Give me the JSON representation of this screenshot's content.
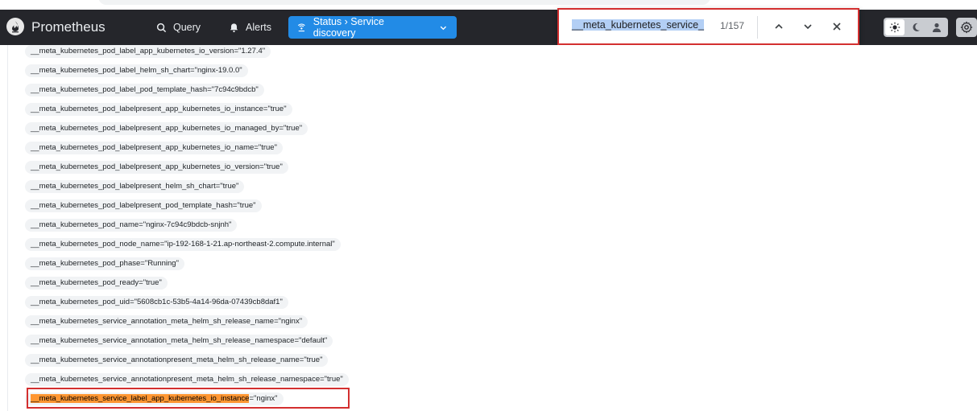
{
  "header": {
    "brand": "Prometheus",
    "nav": {
      "query": "Query",
      "alerts": "Alerts",
      "status": "Status › Service discovery"
    }
  },
  "find": {
    "query_text": "__meta_kubernetes_service_",
    "count": "1/157"
  },
  "labels": [
    {
      "text": "__meta_kubernetes_pod_label_app_kubernetes_io_version=\"1.27.4\""
    },
    {
      "text": "__meta_kubernetes_pod_label_helm_sh_chart=\"nginx-19.0.0\""
    },
    {
      "text": "__meta_kubernetes_pod_label_pod_template_hash=\"7c94c9bdcb\""
    },
    {
      "text": "__meta_kubernetes_pod_labelpresent_app_kubernetes_io_instance=\"true\""
    },
    {
      "text": "__meta_kubernetes_pod_labelpresent_app_kubernetes_io_managed_by=\"true\""
    },
    {
      "text": "__meta_kubernetes_pod_labelpresent_app_kubernetes_io_name=\"true\""
    },
    {
      "text": "__meta_kubernetes_pod_labelpresent_app_kubernetes_io_version=\"true\""
    },
    {
      "text": "__meta_kubernetes_pod_labelpresent_helm_sh_chart=\"true\""
    },
    {
      "text": "__meta_kubernetes_pod_labelpresent_pod_template_hash=\"true\""
    },
    {
      "text": "__meta_kubernetes_pod_name=\"nginx-7c94c9bdcb-snjnh\""
    },
    {
      "text": "__meta_kubernetes_pod_node_name=\"ip-192-168-1-21.ap-northeast-2.compute.internal\""
    },
    {
      "text": "__meta_kubernetes_pod_phase=\"Running\""
    },
    {
      "text": "__meta_kubernetes_pod_ready=\"true\""
    },
    {
      "text": "__meta_kubernetes_pod_uid=\"5608cb1c-53b5-4a14-96da-07439cb8daf1\""
    },
    {
      "text": "__meta_kubernetes_service_annotation_meta_helm_sh_release_name=\"nginx\""
    },
    {
      "text": "__meta_kubernetes_service_annotation_meta_helm_sh_release_namespace=\"default\""
    },
    {
      "text": "__meta_kubernetes_service_annotationpresent_meta_helm_sh_release_name=\"true\""
    },
    {
      "text": "__meta_kubernetes_service_annotationpresent_meta_helm_sh_release_namespace=\"true\""
    }
  ],
  "highlighted_label": {
    "match": "__meta_kubernetes_service_label_app_kubernetes_io_instance",
    "rest": "=\"nginx\""
  },
  "icons": {
    "logo": "prometheus-flame-icon",
    "query": "search-icon",
    "alerts": "bell-icon",
    "status": "broadcast-icon",
    "theme_light": "sun-icon",
    "theme_dark": "moon-icon",
    "theme_user": "user-icon",
    "settings": "gear-icon"
  },
  "colors": {
    "header_bg": "#25262b",
    "accent": "#228be6",
    "find_highlight": "#ff9632",
    "annotation_red": "#d32f2f"
  }
}
